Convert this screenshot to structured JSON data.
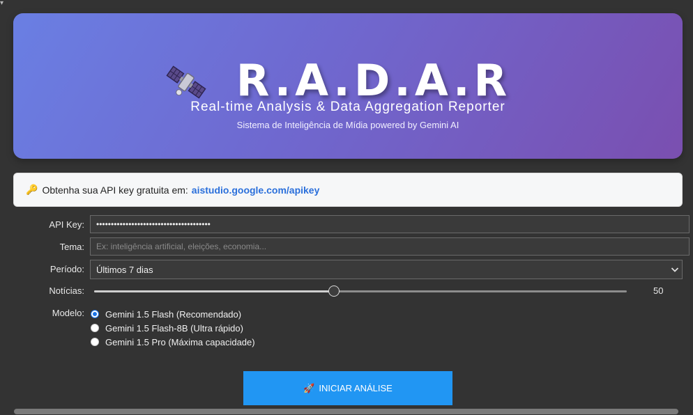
{
  "hero": {
    "title": "R.A.D.A.R",
    "subtitle": "Real-time Analysis & Data Aggregation Reporter",
    "tagline": "Sistema de Inteligência de Mídia powered by Gemini AI",
    "icon": "satellite-icon"
  },
  "notice": {
    "icon": "key-icon",
    "text": "Obtenha sua API key gratuita em:",
    "link": "aistudio.google.com/apikey"
  },
  "form": {
    "api_key": {
      "label": "API Key:",
      "value": "•••••••••••••••••••••••••••••••••••••••"
    },
    "tema": {
      "label": "Tema:",
      "value": "",
      "placeholder": "Ex: inteligência artificial, eleições, economia..."
    },
    "periodo": {
      "label": "Período:",
      "value": "Últimos 7 dias"
    },
    "noticias": {
      "label": "Notícias:",
      "value": "50",
      "fraction": 0.45
    },
    "modelo": {
      "label": "Modelo:",
      "options": [
        {
          "label": "Gemini 1.5 Flash (Recomendado)",
          "checked": true
        },
        {
          "label": "Gemini 1.5 Flash-8B (Ultra rápido)",
          "checked": false
        },
        {
          "label": "Gemini 1.5 Pro (Máxima capacidade)",
          "checked": false
        }
      ]
    }
  },
  "action": {
    "label": "INICIAR ANÁLISE",
    "icon": "rocket-icon"
  },
  "colors": {
    "hero_start": "#6a7fe3",
    "hero_end": "#7a4fb0",
    "button": "#2196f3",
    "link": "#2a6fdb",
    "background": "#333333"
  }
}
